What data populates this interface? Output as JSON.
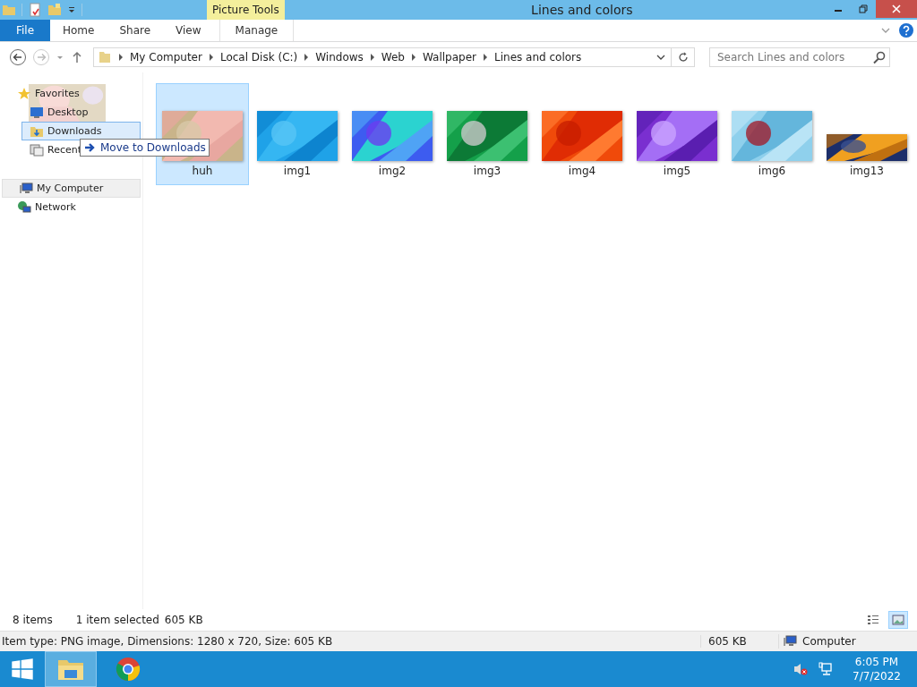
{
  "window": {
    "title": "Lines and colors",
    "context_tab": "Picture Tools"
  },
  "ribbon": {
    "tabs": [
      {
        "label": "File",
        "kind": "file",
        "selected": false
      },
      {
        "label": "Home",
        "kind": "tab",
        "selected": false
      },
      {
        "label": "Share",
        "kind": "tab",
        "selected": false
      },
      {
        "label": "View",
        "kind": "tab",
        "selected": false
      },
      {
        "label": "Manage",
        "kind": "context",
        "selected": false
      }
    ]
  },
  "address": {
    "path": [
      "My Computer",
      "Local Disk (C:)",
      "Windows",
      "Web",
      "Wallpaper",
      "Lines and colors"
    ],
    "search_placeholder": "Search Lines and colors"
  },
  "sidebar": {
    "items": [
      {
        "label": "Favorites",
        "kind": "favorites",
        "selected": false,
        "drop_target": false,
        "children": [
          {
            "label": "Desktop",
            "kind": "desktop",
            "selected": false,
            "drop_target": false
          },
          {
            "label": "Downloads",
            "kind": "downloads",
            "selected": false,
            "drop_target": true
          },
          {
            "label": "Recent",
            "kind": "recent",
            "selected": false,
            "drop_target": false
          }
        ]
      },
      {
        "label": "My Computer",
        "kind": "computer",
        "selected": true,
        "drop_target": false
      },
      {
        "label": "Network",
        "kind": "network",
        "selected": false,
        "drop_target": false
      }
    ]
  },
  "drag": {
    "tooltip": "Move to Downloads"
  },
  "files": [
    {
      "name": "huh",
      "selected": true
    },
    {
      "name": "img1",
      "selected": false
    },
    {
      "name": "img2",
      "selected": false
    },
    {
      "name": "img3",
      "selected": false
    },
    {
      "name": "img4",
      "selected": false
    },
    {
      "name": "img5",
      "selected": false
    },
    {
      "name": "img6",
      "selected": false
    },
    {
      "name": "img13",
      "selected": false
    }
  ],
  "status_bar": {
    "item_count": "8 items",
    "selection": "1 item selected",
    "selection_size": "605 KB",
    "view_modes": [
      {
        "kind": "details",
        "selected": false
      },
      {
        "kind": "large_icons",
        "selected": true
      }
    ]
  },
  "details_bar": {
    "info": "Item type: PNG image, Dimensions: 1280 x 720, Size: 605 KB",
    "size": "605 KB",
    "location": "Computer"
  },
  "taskbar": {
    "apps": [
      {
        "kind": "explorer",
        "selected": true
      },
      {
        "kind": "browser",
        "selected": false
      }
    ],
    "time": "6:05 PM",
    "date": "7/7/2022",
    "muted": true
  }
}
